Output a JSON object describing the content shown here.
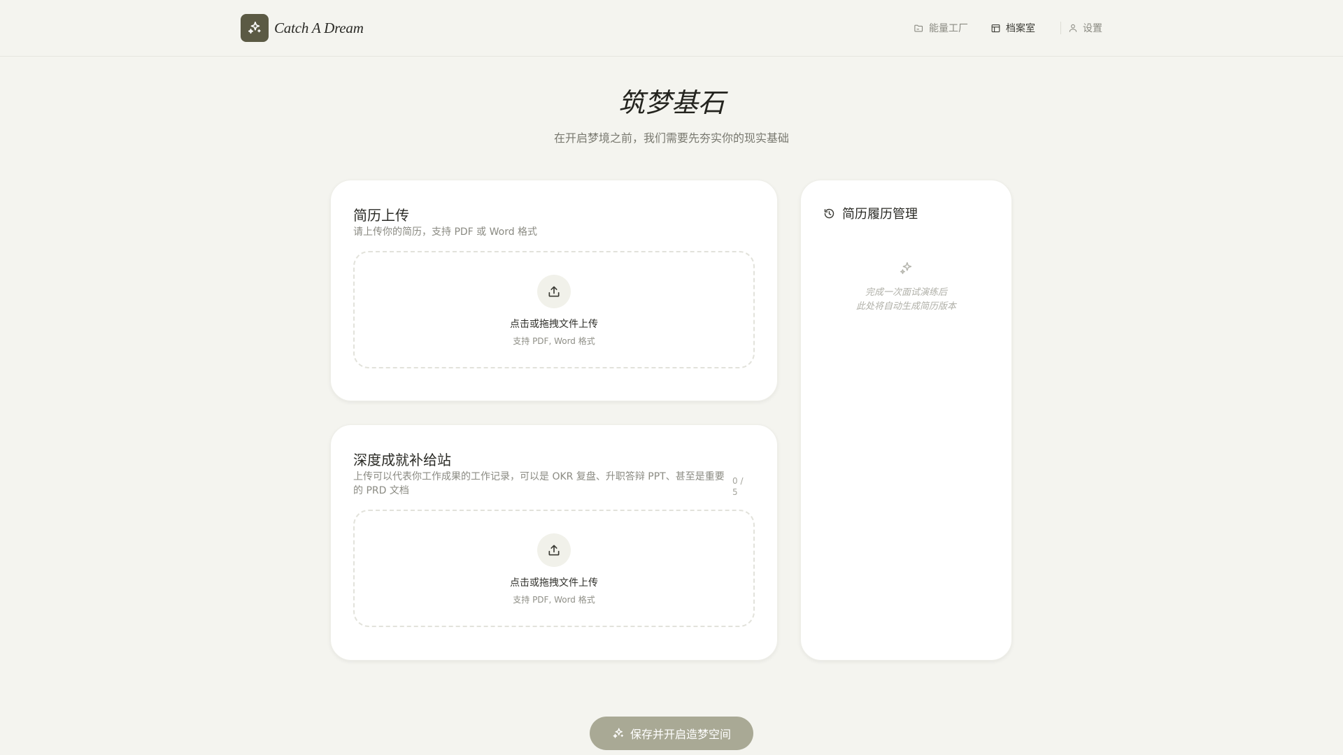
{
  "app": {
    "name": "Catch A Dream"
  },
  "nav": {
    "items": [
      {
        "label": "能量工厂",
        "icon": "folder-icon"
      },
      {
        "label": "档案室",
        "icon": "archive-icon",
        "active": true
      }
    ],
    "settings_label": "设置"
  },
  "hero": {
    "title": "筑梦基石",
    "subtitle": "在开启梦境之前，我们需要先夯实你的现实基础"
  },
  "resume_card": {
    "title": "简历上传",
    "description": "请上传你的简历，支持 PDF 或 Word 格式",
    "dropzone_main": "点击或拖拽文件上传",
    "dropzone_sub": "支持 PDF, Word 格式"
  },
  "achievement_card": {
    "title": "深度成就补给站",
    "description": "上传可以代表你工作成果的工作记录，可以是 OKR 复盘、升职答辩 PPT、甚至是重要的 PRD 文档",
    "counter": "0 / 5",
    "dropzone_main": "点击或拖拽文件上传",
    "dropzone_sub": "支持 PDF, Word 格式"
  },
  "history_card": {
    "title": "简历履历管理",
    "empty_line1": "完成一次面试演练后",
    "empty_line2": "此处将自动生成简历版本"
  },
  "actions": {
    "save_label": "保存并开启造梦空间"
  },
  "colors": {
    "accent": "#5b5a44",
    "button": "#a9a995",
    "background": "#f4f4ef"
  }
}
